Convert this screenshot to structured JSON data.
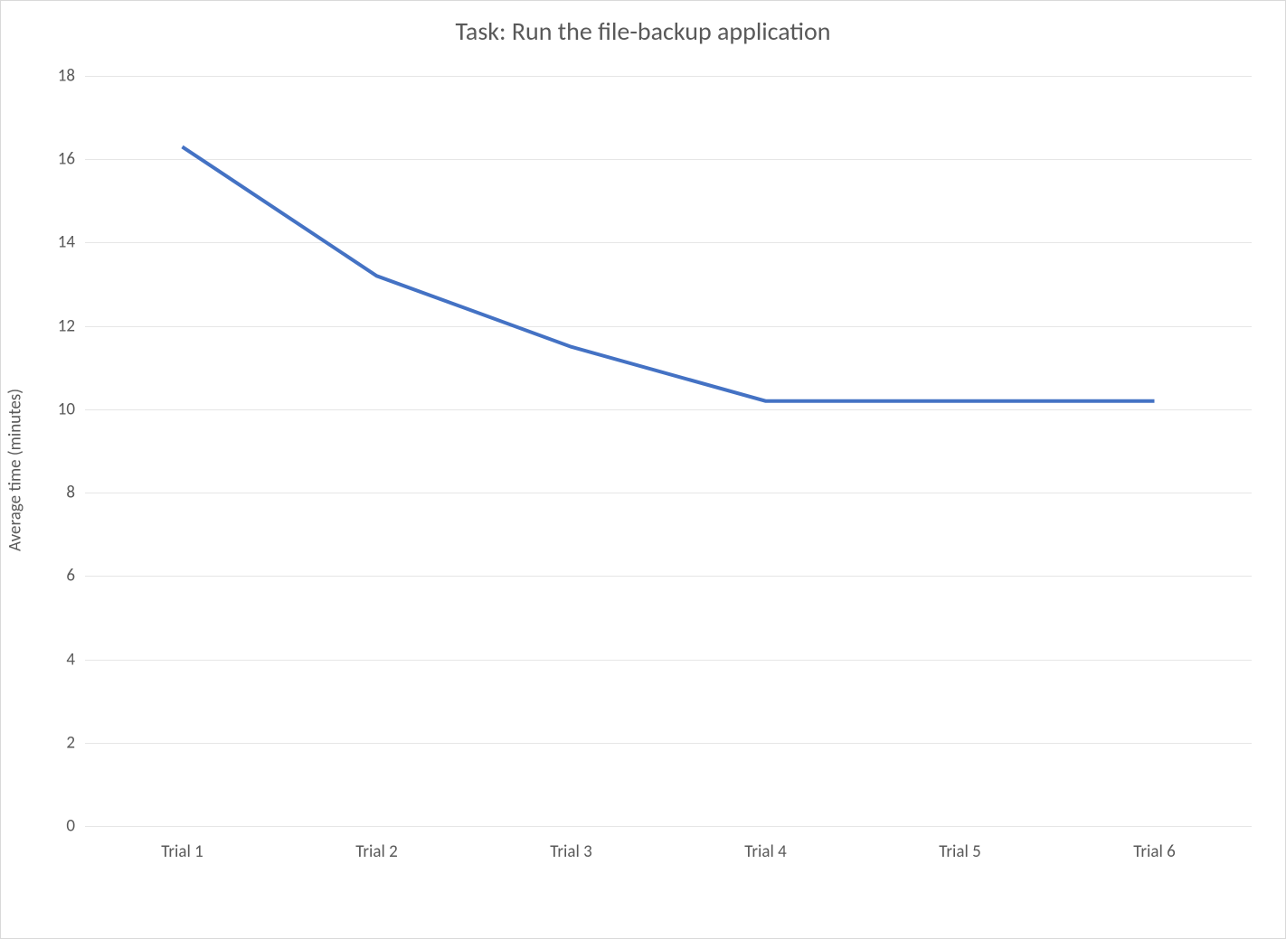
{
  "chart_data": {
    "type": "line",
    "title": "Task: Run the file-backup application",
    "categories": [
      "Trial 1",
      "Trial 2",
      "Trial 3",
      "Trial 4",
      "Trial 5",
      "Trial 6"
    ],
    "values": [
      16.3,
      13.2,
      11.5,
      10.2,
      10.2,
      10.2
    ],
    "xlabel": "",
    "ylabel": "Average time (minutes)",
    "ylim": [
      0,
      18
    ],
    "yticks": [
      0,
      2,
      4,
      6,
      8,
      10,
      12,
      14,
      16,
      18
    ],
    "line_color": "#4472c4",
    "grid": true
  }
}
